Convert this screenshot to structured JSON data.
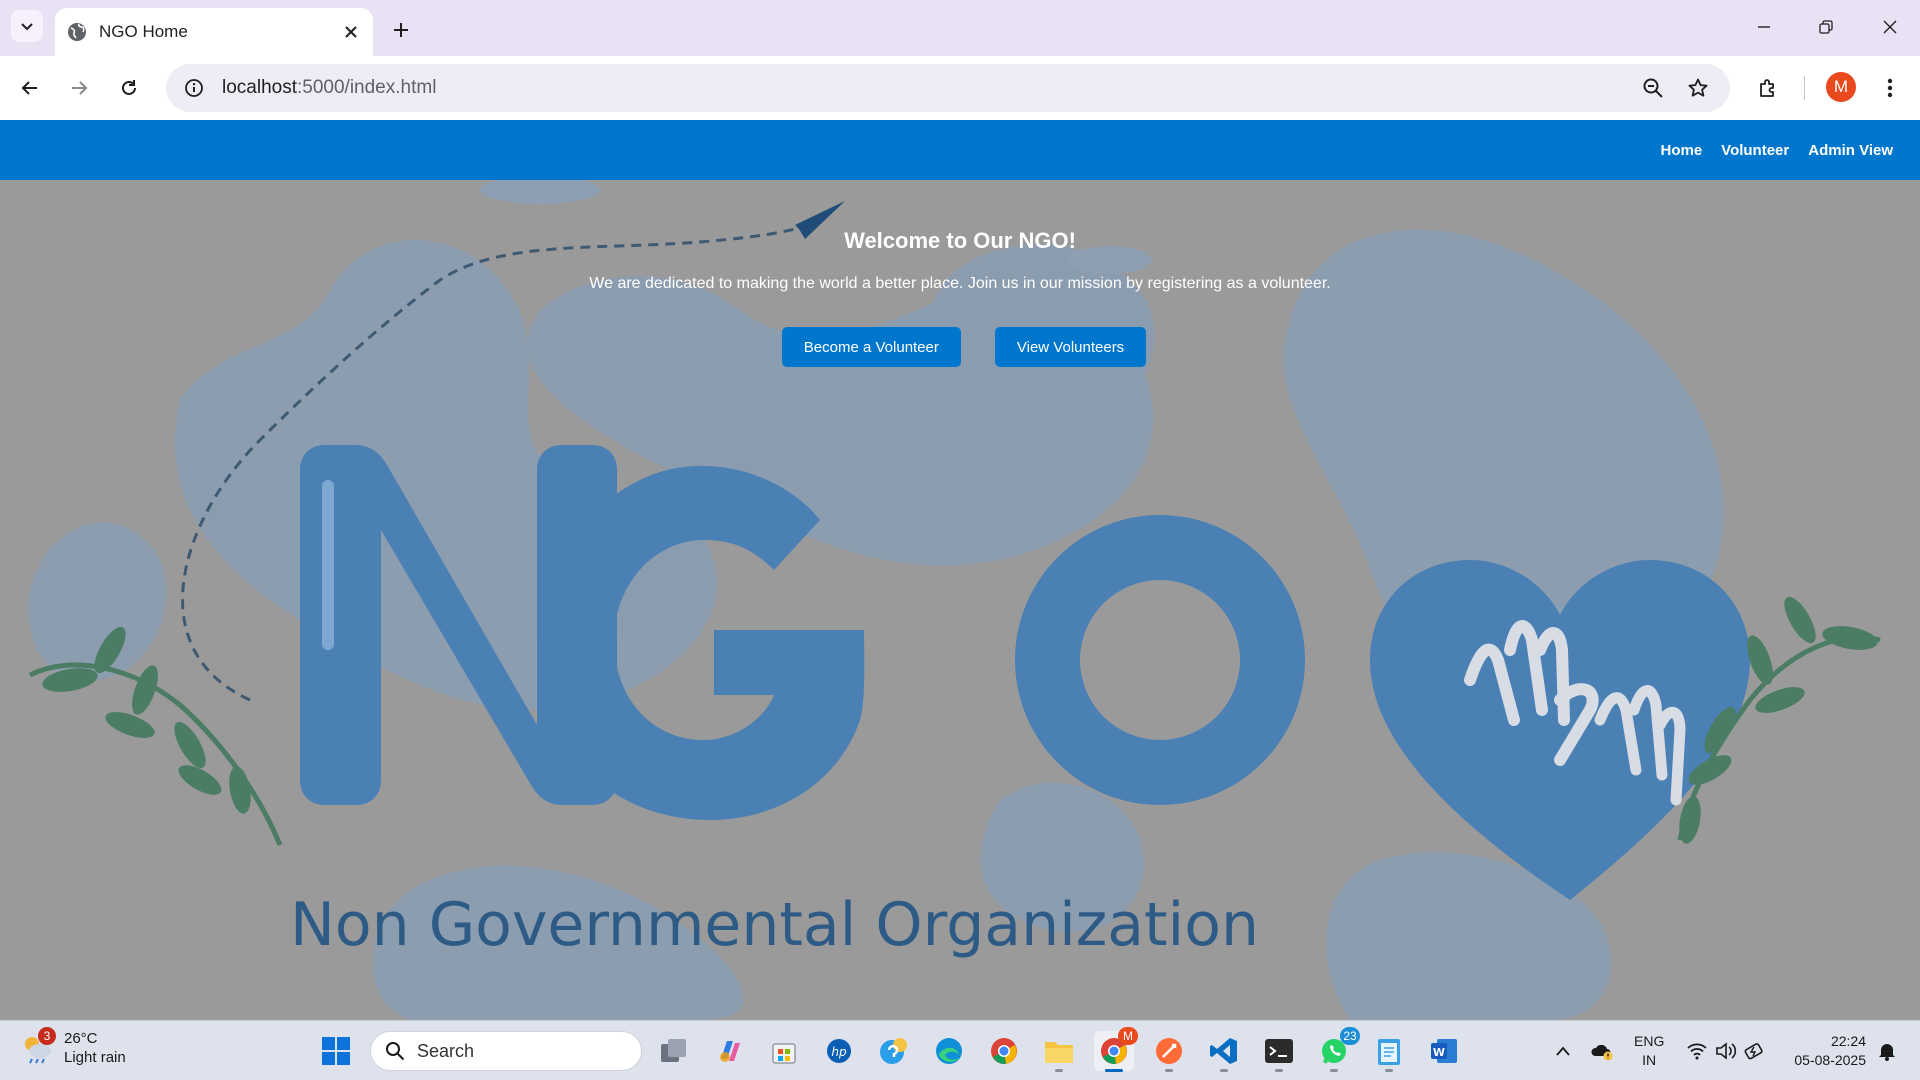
{
  "browser": {
    "tab_title": "NGO Home",
    "url_host": "localhost",
    "url_rest": ":5000/index.html",
    "profile_initial": "M"
  },
  "site": {
    "nav": [
      {
        "label": "Home"
      },
      {
        "label": "Volunteer"
      },
      {
        "label": "Admin View"
      }
    ],
    "hero": {
      "title": "Welcome to Our NGO!",
      "subtitle": "We are dedicated to making the world a better place. Join us in our mission by registering as a volunteer.",
      "buttons": [
        {
          "label": "Become a Volunteer"
        },
        {
          "label": "View Volunteers"
        }
      ]
    },
    "background": {
      "logo_text": "NGO",
      "tagline": "Non Governmental Organization"
    }
  },
  "taskbar": {
    "weather": {
      "badge": "3",
      "temp": "26°C",
      "condition": "Light rain"
    },
    "search_placeholder": "Search",
    "whatsapp_badge": "23",
    "chrome_badge": "M",
    "lang_line1": "ENG",
    "lang_line2": "IN",
    "time": "22:24",
    "date": "05-08-2025"
  },
  "colors": {
    "nav_bar": "#0077cc",
    "button": "#0077cc",
    "page_overlay": "#9a9a9a",
    "logo_blue": "#4a80b4",
    "leaf_green": "#4a7d63"
  }
}
